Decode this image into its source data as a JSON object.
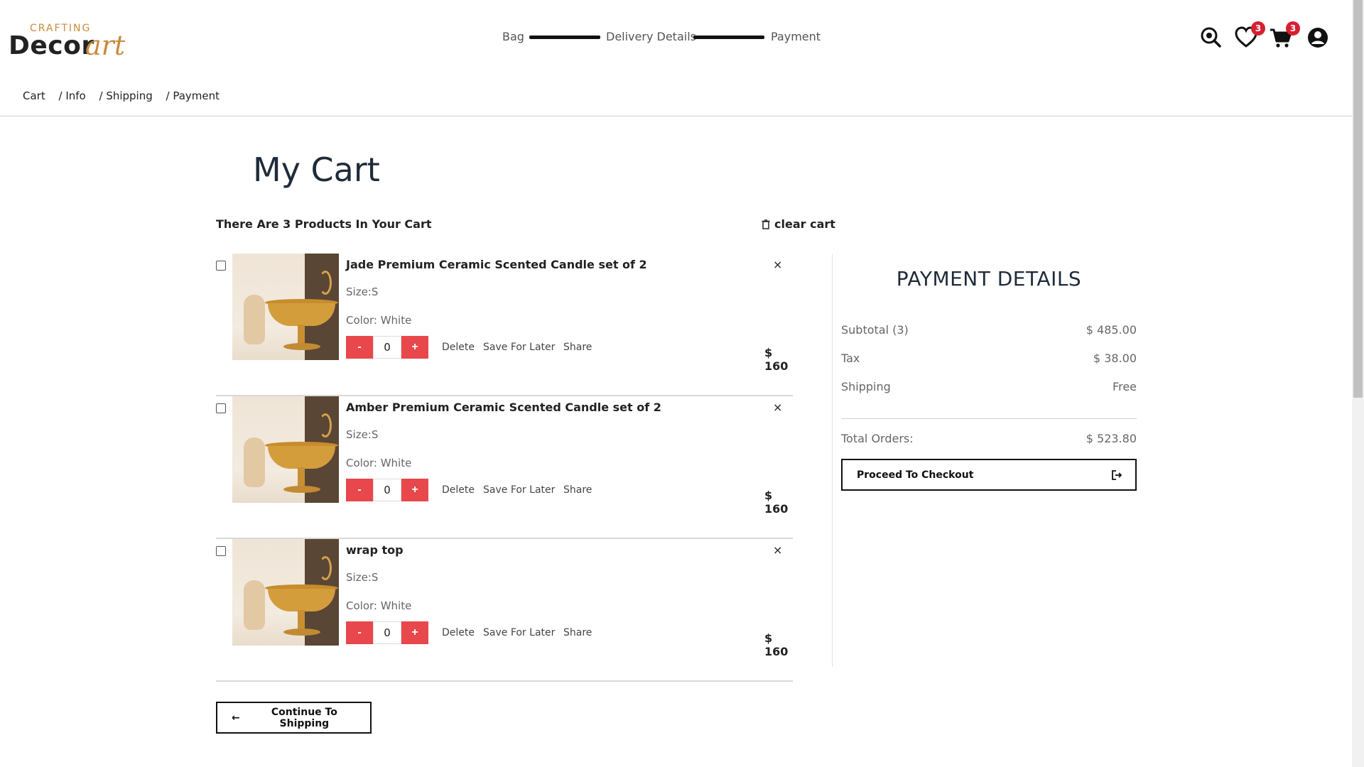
{
  "brand": {
    "top": "CRAFTING",
    "main": "Decor",
    "script": "art"
  },
  "steps": [
    "Bag",
    "Delivery Details",
    "Payment"
  ],
  "header": {
    "wishlist_count": "3",
    "cart_count": "3"
  },
  "breadcrumb": [
    "Cart",
    "/ Info",
    "/ Shipping",
    "/ Payment"
  ],
  "cart": {
    "title": "My Cart",
    "count_text": "There Are 3 Products In Your Cart",
    "clear_label": "clear cart",
    "items": [
      {
        "name": "Jade Premium Ceramic Scented Candle set of 2",
        "size": "Size:S",
        "color": "Color: White",
        "qty": "0",
        "minus": "-",
        "plus": "+",
        "delete": "Delete",
        "save": "Save For Later",
        "share": "Share",
        "price": "$ 160",
        "remove": "×"
      },
      {
        "name": "Amber Premium Ceramic Scented Candle set of 2",
        "size": "Size:S",
        "color": "Color: White",
        "qty": "0",
        "minus": "-",
        "plus": "+",
        "delete": "Delete",
        "save": "Save For Later",
        "share": "Share",
        "price": "$ 160",
        "remove": "×"
      },
      {
        "name": "wrap top",
        "size": "Size:S",
        "color": "Color: White",
        "qty": "0",
        "minus": "-",
        "plus": "+",
        "delete": "Delete",
        "save": "Save For Later",
        "share": "Share",
        "price": "$ 160",
        "remove": "×"
      }
    ],
    "continue_label": "Continue To Shipping",
    "continue_arrow": "←"
  },
  "payment": {
    "title": "PAYMENT DETAILS",
    "subtotal_label": "Subtotal (3)",
    "subtotal_value": "$ 485.00",
    "tax_label": "Tax",
    "tax_value": "$ 38.00",
    "shipping_label": "Shipping",
    "shipping_value": "Free",
    "total_label": "Total Orders:",
    "total_value": "$ 523.80",
    "checkout_label": "Proceed To Checkout"
  },
  "colors": {
    "accent_red": "#e8474c",
    "badge_red": "#d62031",
    "brand_gold": "#c98a3c",
    "ink": "#1f2b3a"
  },
  "icons": [
    "search-icon",
    "heart-icon",
    "cart-icon",
    "user-icon",
    "trash-icon",
    "close-icon",
    "checkout-exit-icon",
    "arrow-left-icon"
  ]
}
